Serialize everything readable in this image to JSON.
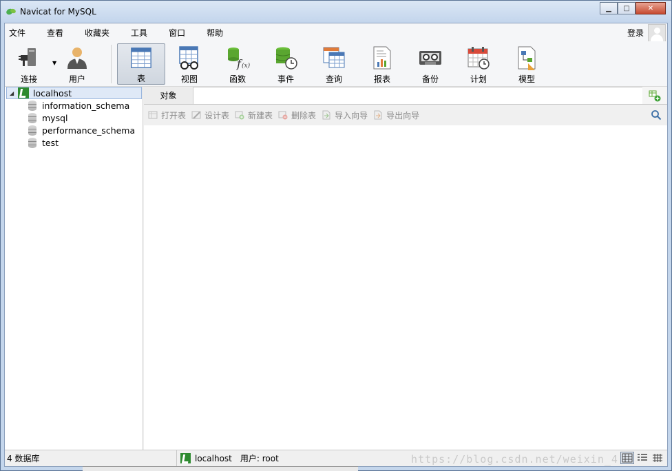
{
  "window": {
    "title": "Navicat for MySQL",
    "minimize": "▁",
    "maximize": "□",
    "close": "✕"
  },
  "menu": {
    "items": [
      "文件",
      "查看",
      "收藏夹",
      "工具",
      "窗口",
      "帮助"
    ],
    "login": "登录"
  },
  "toolbar": {
    "connect": "连接",
    "user": "用户",
    "tools": [
      {
        "label": "表",
        "icon": "table-icon",
        "active": true
      },
      {
        "label": "视图",
        "icon": "view-icon"
      },
      {
        "label": "函数",
        "icon": "function-icon"
      },
      {
        "label": "事件",
        "icon": "event-icon"
      },
      {
        "label": "查询",
        "icon": "query-icon"
      },
      {
        "label": "报表",
        "icon": "report-icon"
      },
      {
        "label": "备份",
        "icon": "backup-icon"
      },
      {
        "label": "计划",
        "icon": "schedule-icon"
      },
      {
        "label": "模型",
        "icon": "model-icon"
      }
    ]
  },
  "tree": {
    "connection": "localhost",
    "databases": [
      "information_schema",
      "mysql",
      "performance_schema",
      "test"
    ]
  },
  "objects": {
    "tab_label": "对象",
    "actions": [
      "打开表",
      "设计表",
      "新建表",
      "删除表",
      "导入向导",
      "导出向导"
    ]
  },
  "status": {
    "db_count": "4 数据库",
    "connection": "localhost",
    "user": "用户: root",
    "watermark": "https://blog.csdn.net/weixin_4"
  },
  "colors": {
    "accent_green": "#2d8a2f",
    "title_bar": "#c3d5ec",
    "selection": "#dfe9f7"
  }
}
